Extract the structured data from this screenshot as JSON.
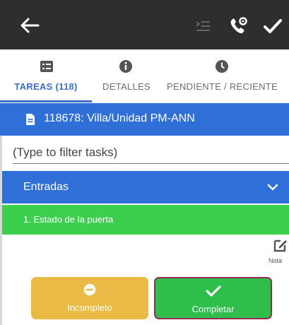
{
  "colors": {
    "appbar": "#2e2e2e",
    "accent_blue": "#2f6fd8",
    "tab_active": "#3b6fc8",
    "item_green": "#3ccf4e",
    "incompleto_yellow": "#e9bb45",
    "completar_green": "#2fbe4b",
    "highlight_border": "#9a2a53"
  },
  "appbar": {
    "icons": [
      "back-arrow-icon",
      "list-indent-icon",
      "phone-settings-icon",
      "check-icon"
    ]
  },
  "tabs": [
    {
      "label": "TAREAS (118)",
      "icon": "list-icon",
      "active": true
    },
    {
      "label": "DETALLES",
      "icon": "info-icon",
      "active": false
    },
    {
      "label": "PENDIENTE / RECIENTE",
      "icon": "clock-icon",
      "active": false
    }
  ],
  "task_header": {
    "icon": "document-icon",
    "title": "118678: Villa/Unidad PM-ANN"
  },
  "filter": {
    "placeholder": "(Type to filter tasks)",
    "value": ""
  },
  "section": {
    "label": "Entradas",
    "icon": "chevron-down-icon"
  },
  "item": {
    "label": "1. Estado de la puerta"
  },
  "notas": {
    "label": "Nota",
    "icon": "edit-icon"
  },
  "buttons": {
    "incompleto": {
      "label": "Incompleto",
      "icon": "minus-circle-icon"
    },
    "completar": {
      "label": "Completar",
      "icon": "check-icon"
    }
  }
}
